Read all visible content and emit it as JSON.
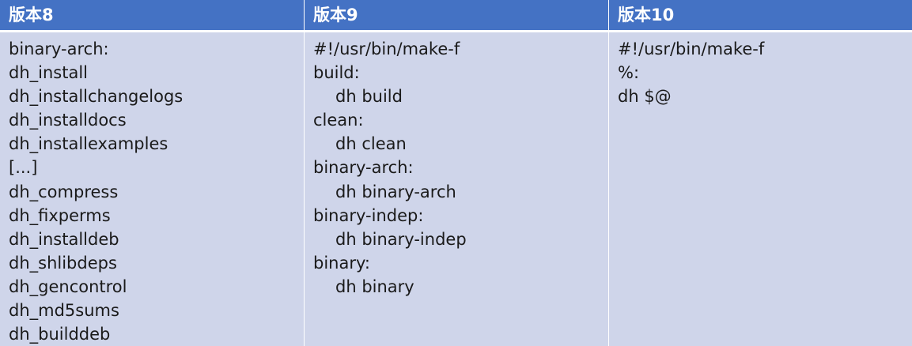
{
  "headers": [
    "版本8",
    "版本9",
    "版本10"
  ],
  "columns": [
    {
      "lines": [
        {
          "text": "binary-arch:",
          "indent": false
        },
        {
          "text": "dh_install",
          "indent": false
        },
        {
          "text": "dh_installchangelogs",
          "indent": false
        },
        {
          "text": "dh_installdocs",
          "indent": false
        },
        {
          "text": "dh_installexamples",
          "indent": false
        },
        {
          "text": "[...]",
          "indent": false
        },
        {
          "text": "dh_compress",
          "indent": false
        },
        {
          "text": "dh_fixperms",
          "indent": false
        },
        {
          "text": "dh_installdeb",
          "indent": false
        },
        {
          "text": "dh_shlibdeps",
          "indent": false
        },
        {
          "text": "dh_gencontrol",
          "indent": false
        },
        {
          "text": "dh_md5sums",
          "indent": false
        },
        {
          "text": "dh_builddeb",
          "indent": false
        }
      ]
    },
    {
      "lines": [
        {
          "text": "#!/usr/bin/make-f",
          "indent": false
        },
        {
          "text": "build:",
          "indent": false
        },
        {
          "text": "dh build",
          "indent": true
        },
        {
          "text": "clean:",
          "indent": false
        },
        {
          "text": "dh clean",
          "indent": true
        },
        {
          "text": "binary-arch:",
          "indent": false
        },
        {
          "text": "dh binary-arch",
          "indent": true
        },
        {
          "text": "binary-indep:",
          "indent": false
        },
        {
          "text": "dh binary-indep",
          "indent": true
        },
        {
          "text": "binary:",
          "indent": false
        },
        {
          "text": "dh binary",
          "indent": true
        }
      ]
    },
    {
      "lines": [
        {
          "text": "#!/usr/bin/make-f",
          "indent": false
        },
        {
          "text": "%:",
          "indent": false
        },
        {
          "text": "dh $@",
          "indent": false
        }
      ]
    }
  ],
  "colors": {
    "header_bg": "#4472c4",
    "header_text": "#ffffff",
    "cell_bg": "#cfd5ea",
    "cell_text": "#1a1a1a"
  }
}
